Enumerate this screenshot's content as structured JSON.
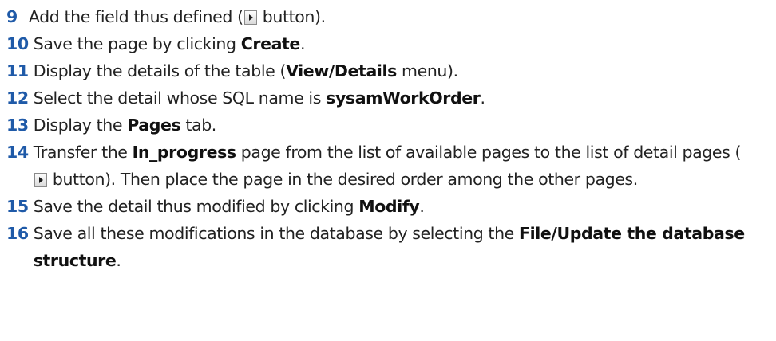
{
  "steps": [
    {
      "num": "9",
      "parts": [
        "Add the field thus defined (",
        {
          "icon": "arrow-right-button-icon"
        },
        " button)."
      ]
    },
    {
      "num": "10",
      "parts": [
        "Save the page by clicking ",
        {
          "b": "Create"
        },
        "."
      ]
    },
    {
      "num": "11",
      "parts": [
        "Display the details of the table (",
        {
          "b": "View/Details"
        },
        " menu)."
      ]
    },
    {
      "num": "12",
      "parts": [
        "Select the detail whose SQL name is ",
        {
          "b": "sysamWorkOrder"
        },
        "."
      ]
    },
    {
      "num": "13",
      "parts": [
        "Display the ",
        {
          "b": "Pages"
        },
        " tab."
      ]
    },
    {
      "num": "14",
      "parts": [
        "Transfer the ",
        {
          "b": "In_progress"
        },
        " page from the list of available pages to the list of detail pages (",
        {
          "icon": "arrow-right-button-icon"
        },
        " button). Then place the page in the desired order among the other pages."
      ]
    },
    {
      "num": "15",
      "parts": [
        "Save the detail thus modified by clicking ",
        {
          "b": "Modify"
        },
        "."
      ]
    },
    {
      "num": "16",
      "parts": [
        "Save all these modifications in the database by selecting the ",
        {
          "b": "File/Update the database structure"
        },
        "."
      ]
    }
  ]
}
